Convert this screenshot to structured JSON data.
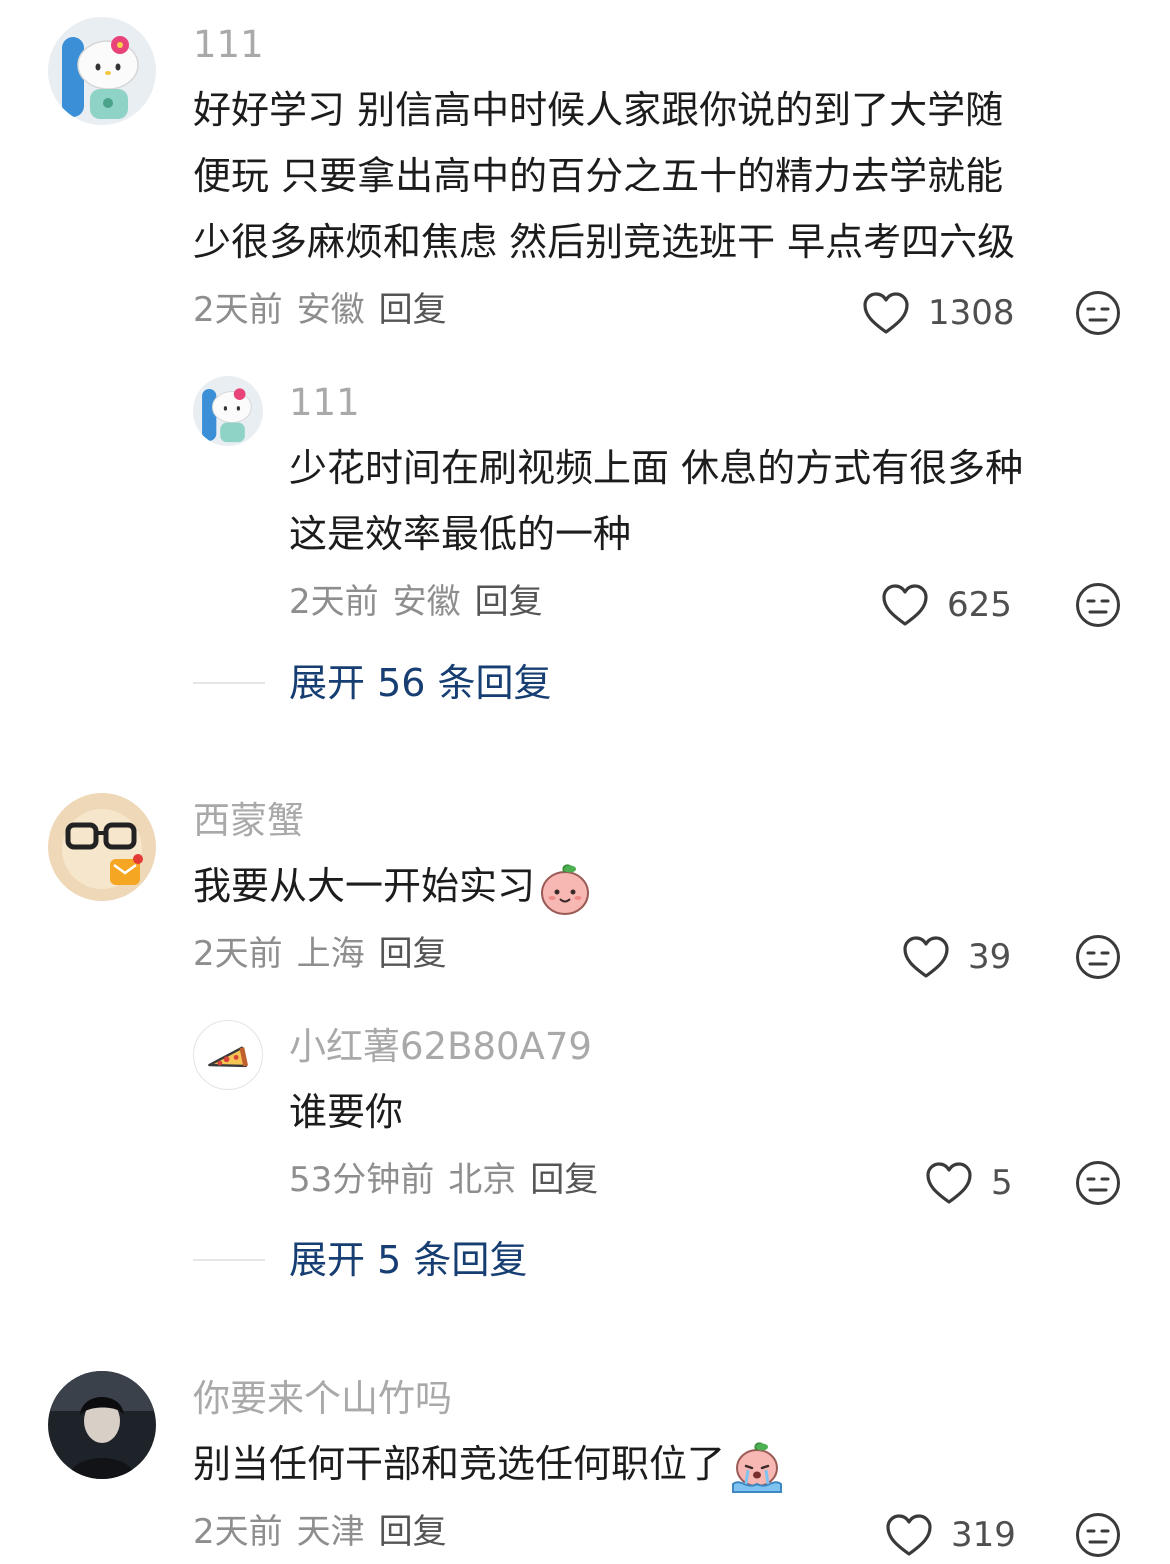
{
  "colors": {
    "name": "#a9a9a9",
    "meta": "#8e8e8e",
    "expand": "#173e72",
    "text": "#1c1c1c"
  },
  "comments": [
    {
      "username": "111",
      "avatar": "hello-kitty-avatar",
      "lines": [
        "好好学习 别信高中时候人家跟你说的到了大学随",
        "便玩 只要拿出高中的百分之五十的精力去学就能",
        "少很多麻烦和焦虑 然后别竞选班干 早点考四六级"
      ],
      "time": "2天前",
      "location": "安徽",
      "reply_label": "回复",
      "likes": "1308",
      "replies": [
        {
          "username": "111",
          "avatar": "hello-kitty-avatar",
          "lines": [
            "少花时间在刷视频上面 休息的方式有很多种",
            "这是效率最低的一种"
          ],
          "time": "2天前",
          "location": "安徽",
          "reply_label": "回复",
          "likes": "625"
        }
      ],
      "expand_label": "展开 56 条回复"
    },
    {
      "username": "西蒙蟹",
      "avatar": "glasses-cat-avatar",
      "lines": [
        "我要从大一开始实习"
      ],
      "emoji": "peach-smile-emoji",
      "time": "2天前",
      "location": "上海",
      "reply_label": "回复",
      "likes": "39",
      "replies": [
        {
          "username": "小红薯62B80A79",
          "avatar": "pizza-avatar",
          "lines": [
            "谁要你"
          ],
          "time": "53分钟前",
          "location": "北京",
          "reply_label": "回复",
          "likes": "5"
        }
      ],
      "expand_label": "展开 5 条回复"
    },
    {
      "username": "你要来个山竹吗",
      "avatar": "dark-portrait-avatar",
      "lines": [
        "别当任何干部和竞选任何职位了"
      ],
      "emoji": "peach-crying-emoji",
      "time": "2天前",
      "location": "天津",
      "reply_label": "回复",
      "likes": "319"
    }
  ]
}
